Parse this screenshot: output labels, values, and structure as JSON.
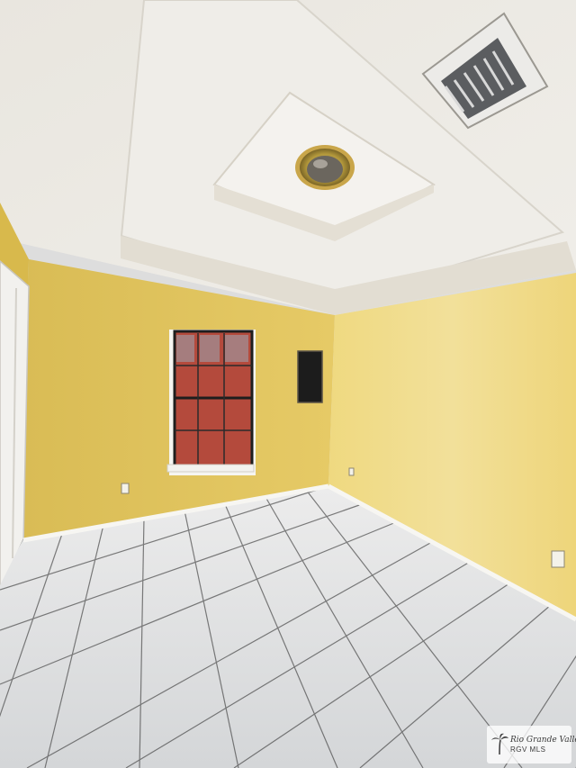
{
  "watermark": {
    "line1": "Rio Grande Valley",
    "line2": "RGV MLS"
  }
}
